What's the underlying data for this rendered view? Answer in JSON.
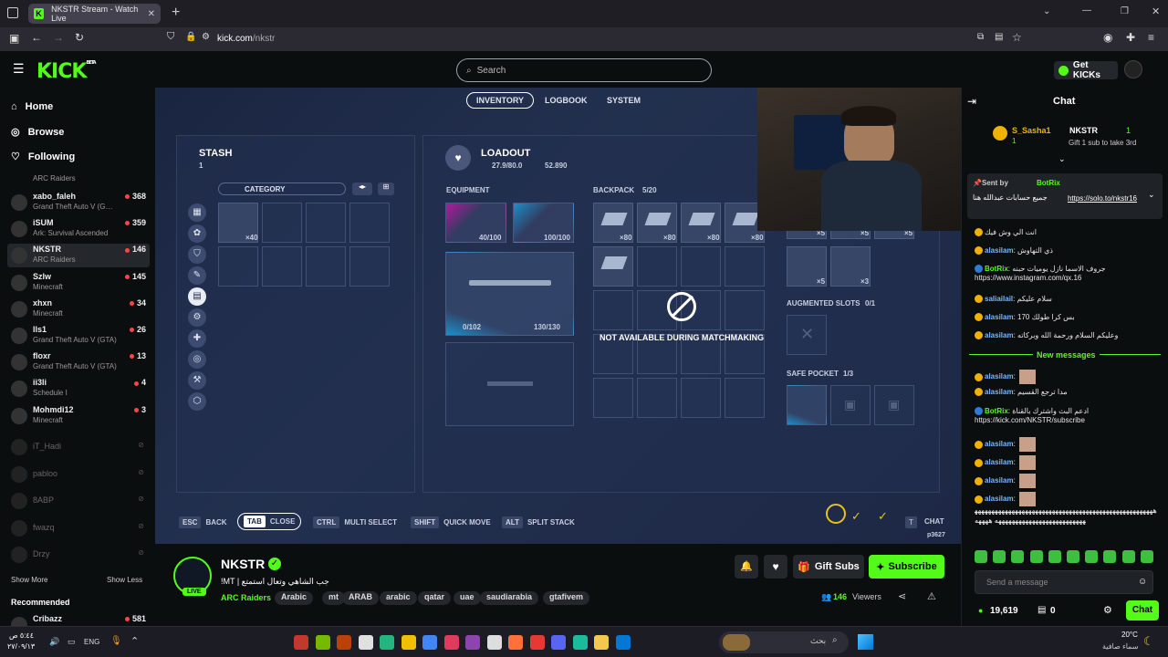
{
  "browser": {
    "tab_title": "NKSTR Stream - Watch Live",
    "url_domain": "kick.com",
    "url_path": "/nkstr",
    "new_tab": "+"
  },
  "header": {
    "logo": "KICK",
    "logo_sup": "BETA",
    "search_placeholder": "Search",
    "get_kicks": "Get KICKs"
  },
  "sidebar": {
    "nav": [
      {
        "label": "Home",
        "icon": "home-icon"
      },
      {
        "label": "Browse",
        "icon": "compass-icon"
      },
      {
        "label": "Following",
        "icon": "heart-icon"
      }
    ],
    "prev_category": "ARC Raiders",
    "channels": [
      {
        "name": "xabo_faleh",
        "category": "Grand Theft Auto V (G…",
        "viewers": "368"
      },
      {
        "name": "iSUM",
        "category": "Ark: Survival Ascended",
        "viewers": "359"
      },
      {
        "name": "NKSTR",
        "category": "ARC Raiders",
        "viewers": "146",
        "active": true
      },
      {
        "name": "Szlw",
        "category": "Minecraft",
        "viewers": "145"
      },
      {
        "name": "xhxn",
        "category": "Minecraft",
        "viewers": "34"
      },
      {
        "name": "lls1",
        "category": "Grand Theft Auto V (GTA)",
        "viewers": "26"
      },
      {
        "name": "floxr",
        "category": "Grand Theft Auto V (GTA)",
        "viewers": "13"
      },
      {
        "name": "ii3li",
        "category": "Schedule I",
        "viewers": "4"
      },
      {
        "name": "Mohmdi12",
        "category": "Minecraft",
        "viewers": "3"
      }
    ],
    "offline": [
      "iT_Hadi",
      "pabloo",
      "8ABP",
      "fwazq",
      "Drzy"
    ],
    "show_more": "Show More",
    "show_less": "Show Less",
    "recommended_title": "Recommended",
    "recommended": [
      {
        "name": "Cribazz",
        "viewers": "581"
      }
    ]
  },
  "game": {
    "tabs": [
      "INVENTORY",
      "LOGBOOK",
      "SYSTEM"
    ],
    "stash_title": "STASH",
    "stash_count": "1",
    "category": "CATEGORY",
    "stash_item_qty": "×40",
    "loadout_title": "LOADOUT",
    "loadout_weight": "27.9/80.0",
    "loadout_money": "52.890",
    "equipment": "EQUIPMENT",
    "backpack": "BACKPACK",
    "backpack_count": "5/20",
    "eq1": "40/100",
    "eq2": "100/100",
    "weapon_ammo": "0/102",
    "weapon_dur": "130/130",
    "bp_qty": "×80",
    "qty5": "×5",
    "qty3": "×3",
    "augmented": "AUGMENTED SLOTS",
    "augmented_count": "0/1",
    "safe_pocket": "SAFE POCKET",
    "safe_count": "1/3",
    "not_available": "NOT AVAILABLE DURING MATCHMAKING",
    "controls": [
      {
        "key": "ESC",
        "label": "BACK"
      },
      {
        "key": "TAB",
        "label": "CLOSE"
      },
      {
        "key": "CTRL",
        "label": "MULTI SELECT"
      },
      {
        "key": "SHIFT",
        "label": "QUICK MOVE"
      },
      {
        "key": "ALT",
        "label": "SPLIT STACK"
      }
    ],
    "chat_key": "T",
    "chat_label": "CHAT",
    "code": "p3627"
  },
  "stream": {
    "streamer": "NKSTR",
    "title": "!MT | جب الشاهي وتعال استمتع",
    "category": "ARC Raiders",
    "tags": [
      "Arabic",
      "mt",
      "ARAB",
      "arabic",
      "qatar",
      "uae",
      "saudiarabia",
      "gtafivem"
    ],
    "viewers": "146",
    "viewers_label": "Viewers",
    "gift_subs": "Gift Subs",
    "subscribe": "Subscribe",
    "live": "LIVE"
  },
  "chat": {
    "title": "Chat",
    "top_gifter": "S_Sasha1",
    "top_gifter_count": "1",
    "top_gift_channel": "NKSTR",
    "top_gift_channel_count": "1",
    "gift_note": "Gift 1 sub to take 3rd",
    "pinned_by_label": "Sent by",
    "pinned_by": "BotRix",
    "pinned_text": "جميع حسابات عبدالله هنا",
    "pinned_link": "https://solo.to/nkstr16",
    "messages": [
      {
        "user": "",
        "text": "انت الي وش فيك"
      },
      {
        "user": "alasilam",
        "text": "ذي التهاوش"
      },
      {
        "user": "BotRix",
        "text": "جروف الاسما نازل يوميات حبنه https://www.instagram.com/qx.16"
      },
      {
        "user": "saliailail",
        "text": "سلام عليكم"
      },
      {
        "user": "alasilam",
        "text": "170 بس كرا طولك"
      },
      {
        "user": "alasilam",
        "text": "وعليكم السلام ورحمة الله وبركاته"
      }
    ],
    "new_messages": "New messages",
    "messages2": [
      {
        "user": "alasilam",
        "text": ""
      },
      {
        "user": "alasilam",
        "text": "مدا ترجع القسيم"
      },
      {
        "user": "BotRix",
        "text": "ادعم البث واشترك بالقناة https://kick.com/NKSTR/subscribe"
      },
      {
        "user": "alasilam",
        "text": ""
      },
      {
        "user": "alasilam",
        "text": ""
      },
      {
        "user": "alasilam",
        "text": ""
      },
      {
        "user": "alasilam",
        "text": ""
      }
    ],
    "spam": "ههههههههههههههههههههههههههههههههههههههههههههههههههههههههههههههههههههههههههههههههه ههههه",
    "input_placeholder": "Send a message",
    "kicks": "19,619",
    "zero": "0",
    "chat_button": "Chat"
  },
  "taskbar": {
    "search": "بحث",
    "lang": "ENG",
    "time": "٥:٤٤ ص",
    "date": "٢٧/٠٩/١٣",
    "temp": "20°C",
    "weather": "سماء صافية"
  }
}
